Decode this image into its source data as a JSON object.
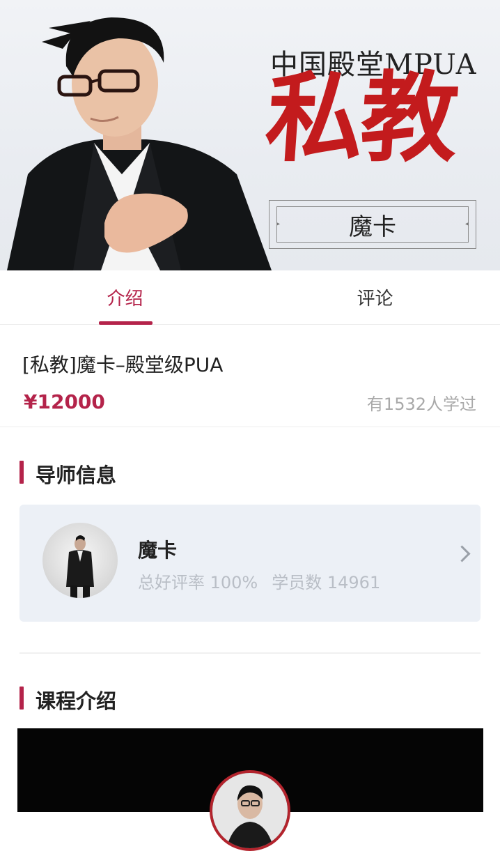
{
  "banner": {
    "subtitle": "中国殿堂MPUA",
    "title": "私教",
    "coach_name": "魔卡",
    "accent_color": "#c31b1d"
  },
  "tabs": [
    {
      "label": "介绍",
      "active": true
    },
    {
      "label": "评论",
      "active": false
    }
  ],
  "course": {
    "title": "[私教]魔卡–殿堂级PUA",
    "price": "¥12000",
    "learners": "有1532人学过"
  },
  "mentor_section": {
    "heading": "导师信息",
    "name": "魔卡",
    "rating": "总好评率 100%",
    "students": "学员数 14961"
  },
  "intro_section": {
    "heading": "课程介绍"
  },
  "colors": {
    "brand": "#b4234a",
    "card_bg": "#ecf0f6",
    "muted_text": "#a9a9a9"
  },
  "icons": {
    "chevron": "chevron-right-icon"
  }
}
